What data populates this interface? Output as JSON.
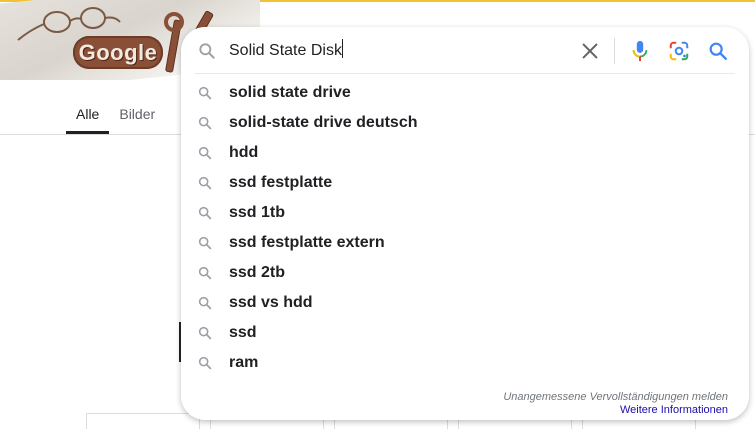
{
  "doodle": {
    "logo_text": "Google"
  },
  "tabs": [
    {
      "label": "Alle",
      "active": true
    },
    {
      "label": "Bilder",
      "active": false
    }
  ],
  "search": {
    "value": "Solid State Disk"
  },
  "suggestions": [
    "solid state drive",
    "solid-state drive deutsch",
    "hdd",
    "ssd festplatte",
    "ssd 1tb",
    "ssd festplatte extern",
    "ssd 2tb",
    "ssd vs hdd",
    "ssd",
    "ram"
  ],
  "footer": {
    "report_label": "Unangemessene Vervollständigungen melden",
    "more_info_label": "Weitere Informationen"
  },
  "icons": {
    "search": "search-icon",
    "clear": "close-icon",
    "mic": "mic-icon",
    "lens": "camera-lens-icon"
  },
  "colors": {
    "accent_blue": "#4285f4",
    "mic_red": "#ea4335",
    "text": "#202124",
    "muted": "#70757a",
    "link": "#1a0dab"
  }
}
